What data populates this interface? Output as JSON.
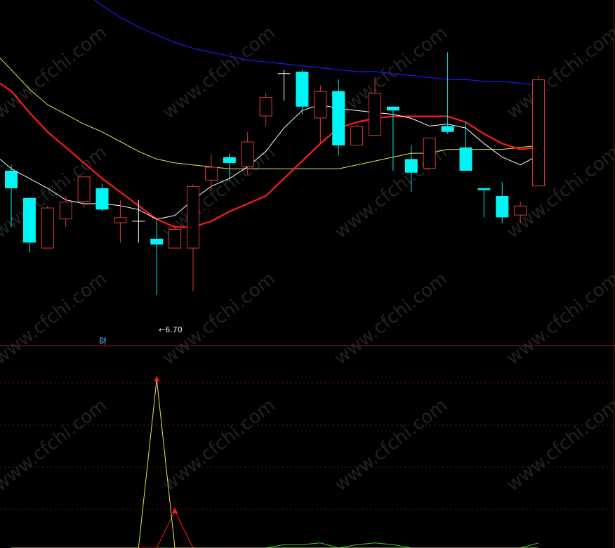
{
  "chart_data": {
    "type": "candlestick",
    "colors": {
      "background": "#000000",
      "up_candle": "#e03a3a",
      "down_candle": "#00f5f5",
      "flat_candle": "#ffffff",
      "ma_fast": "#ffffff",
      "ma_yellow": "#e6e650",
      "ma_red": "#ff1a1a",
      "ma_blue": "#1a1aff",
      "divider": "#9a1a1a",
      "indicator_grid": "#7a1010",
      "indicator_yellow": "#e6e650",
      "indicator_red": "#ff1a1a",
      "indicator_green": "#30d030"
    },
    "price_range": [
      6.5,
      8.2
    ],
    "candles": [
      {
        "o": 7.35,
        "h": 7.38,
        "l": 7.06,
        "c": 7.26
      },
      {
        "o": 7.21,
        "h": 7.21,
        "l": 6.93,
        "c": 6.98
      },
      {
        "o": 6.95,
        "h": 7.17,
        "l": 6.95,
        "c": 7.16
      },
      {
        "o": 7.1,
        "h": 7.22,
        "l": 7.06,
        "c": 7.19
      },
      {
        "o": 7.19,
        "h": 7.32,
        "l": 7.16,
        "c": 7.32
      },
      {
        "o": 7.26,
        "h": 7.28,
        "l": 7.14,
        "c": 7.15
      },
      {
        "o": 7.08,
        "h": 7.2,
        "l": 6.98,
        "c": 7.11
      },
      {
        "o": 7.09,
        "h": 7.2,
        "l": 6.98,
        "c": 7.09
      },
      {
        "o": 7.0,
        "h": 7.09,
        "l": 6.71,
        "c": 6.97
      },
      {
        "o": 6.95,
        "h": 7.07,
        "l": 6.95,
        "c": 7.05
      },
      {
        "o": 6.95,
        "h": 7.28,
        "l": 6.73,
        "c": 7.27
      },
      {
        "o": 7.3,
        "h": 7.43,
        "l": 7.25,
        "c": 7.37
      },
      {
        "o": 7.42,
        "h": 7.44,
        "l": 7.3,
        "c": 7.39
      },
      {
        "o": 7.37,
        "h": 7.55,
        "l": 7.33,
        "c": 7.5
      },
      {
        "o": 7.63,
        "h": 7.75,
        "l": 7.58,
        "c": 7.73
      },
      {
        "o": 7.85,
        "h": 7.87,
        "l": 7.71,
        "c": 7.85
      },
      {
        "o": 7.86,
        "h": 7.87,
        "l": 7.64,
        "c": 7.68
      },
      {
        "o": 7.62,
        "h": 7.79,
        "l": 7.49,
        "c": 7.76
      },
      {
        "o": 7.76,
        "h": 7.82,
        "l": 7.43,
        "c": 7.48
      },
      {
        "o": 7.48,
        "h": 7.59,
        "l": 7.48,
        "c": 7.58
      },
      {
        "o": 7.53,
        "h": 7.83,
        "l": 7.53,
        "c": 7.75
      },
      {
        "o": 7.68,
        "h": 7.68,
        "l": 7.35,
        "c": 7.66
      },
      {
        "o": 7.41,
        "h": 7.48,
        "l": 7.24,
        "c": 7.34
      },
      {
        "o": 7.36,
        "h": 7.52,
        "l": 7.36,
        "c": 7.52
      },
      {
        "o": 7.58,
        "h": 7.96,
        "l": 7.54,
        "c": 7.55
      },
      {
        "o": 7.47,
        "h": 7.6,
        "l": 7.35,
        "c": 7.35
      },
      {
        "o": 7.26,
        "h": 7.26,
        "l": 7.11,
        "c": 7.25
      },
      {
        "o": 7.22,
        "h": 7.29,
        "l": 7.08,
        "c": 7.11
      },
      {
        "o": 7.12,
        "h": 7.19,
        "l": 7.08,
        "c": 7.17
      },
      {
        "o": 7.27,
        "h": 7.84,
        "l": 7.27,
        "c": 7.82
      }
    ],
    "ma_fast": [
      7.36,
      7.31,
      7.26,
      7.2,
      7.18,
      7.18,
      7.17,
      7.15,
      7.1,
      7.12,
      7.2,
      7.27,
      7.31,
      7.37,
      7.45,
      7.57,
      7.66,
      7.69,
      7.67,
      7.66,
      7.65,
      7.64,
      7.62,
      7.58,
      7.59,
      7.57,
      7.49,
      7.42,
      7.38,
      7.43
    ],
    "ma_yellow": [
      7.87,
      7.77,
      7.69,
      7.64,
      7.59,
      7.55,
      7.5,
      7.45,
      7.41,
      7.39,
      7.38,
      7.37,
      7.36,
      7.36,
      7.36,
      7.36,
      7.36,
      7.36,
      7.36,
      7.38,
      7.4,
      7.42,
      7.44,
      7.44,
      7.46,
      7.46,
      7.46,
      7.46,
      7.47,
      7.48
    ],
    "ma_red": [
      7.76,
      7.65,
      7.55,
      7.47,
      7.39,
      7.31,
      7.24,
      7.17,
      7.1,
      7.06,
      7.06,
      7.09,
      7.14,
      7.18,
      7.22,
      7.31,
      7.4,
      7.49,
      7.57,
      7.6,
      7.62,
      7.63,
      7.63,
      7.63,
      7.63,
      7.6,
      7.54,
      7.49,
      7.46,
      7.47
    ],
    "ma_blue": [
      8.53,
      8.47,
      8.4,
      8.33,
      8.27,
      8.2,
      8.14,
      8.09,
      8.05,
      8.01,
      7.98,
      7.96,
      7.94,
      7.92,
      7.91,
      7.9,
      7.89,
      7.88,
      7.87,
      7.86,
      7.86,
      7.85,
      7.84,
      7.83,
      7.82,
      7.82,
      7.81,
      7.81,
      7.8,
      7.79
    ],
    "low_label": "←6.70",
    "marker": "财",
    "indicator": {
      "range": [
        0,
        100
      ],
      "yellow": [
        0,
        0,
        0,
        0,
        0,
        0,
        0,
        0,
        100,
        0,
        0,
        0,
        0,
        0,
        0,
        0,
        0,
        0,
        0,
        0,
        0,
        0,
        0,
        0,
        0,
        0,
        0,
        0,
        0,
        0
      ],
      "red": [
        0,
        0,
        0,
        0,
        0,
        0,
        0,
        0,
        0,
        22,
        0,
        0,
        0,
        0,
        0,
        0,
        0,
        0,
        0,
        0,
        0,
        0,
        0,
        0,
        0,
        0,
        0,
        0,
        0,
        0
      ],
      "green": [
        0,
        0,
        0,
        0,
        0,
        0,
        0,
        0,
        0,
        0,
        0,
        0,
        0,
        0,
        0,
        2,
        2,
        3,
        0,
        2,
        3,
        2,
        0,
        0,
        0,
        0,
        0,
        0,
        0,
        3
      ]
    }
  },
  "watermark": "www.cfchi.com"
}
